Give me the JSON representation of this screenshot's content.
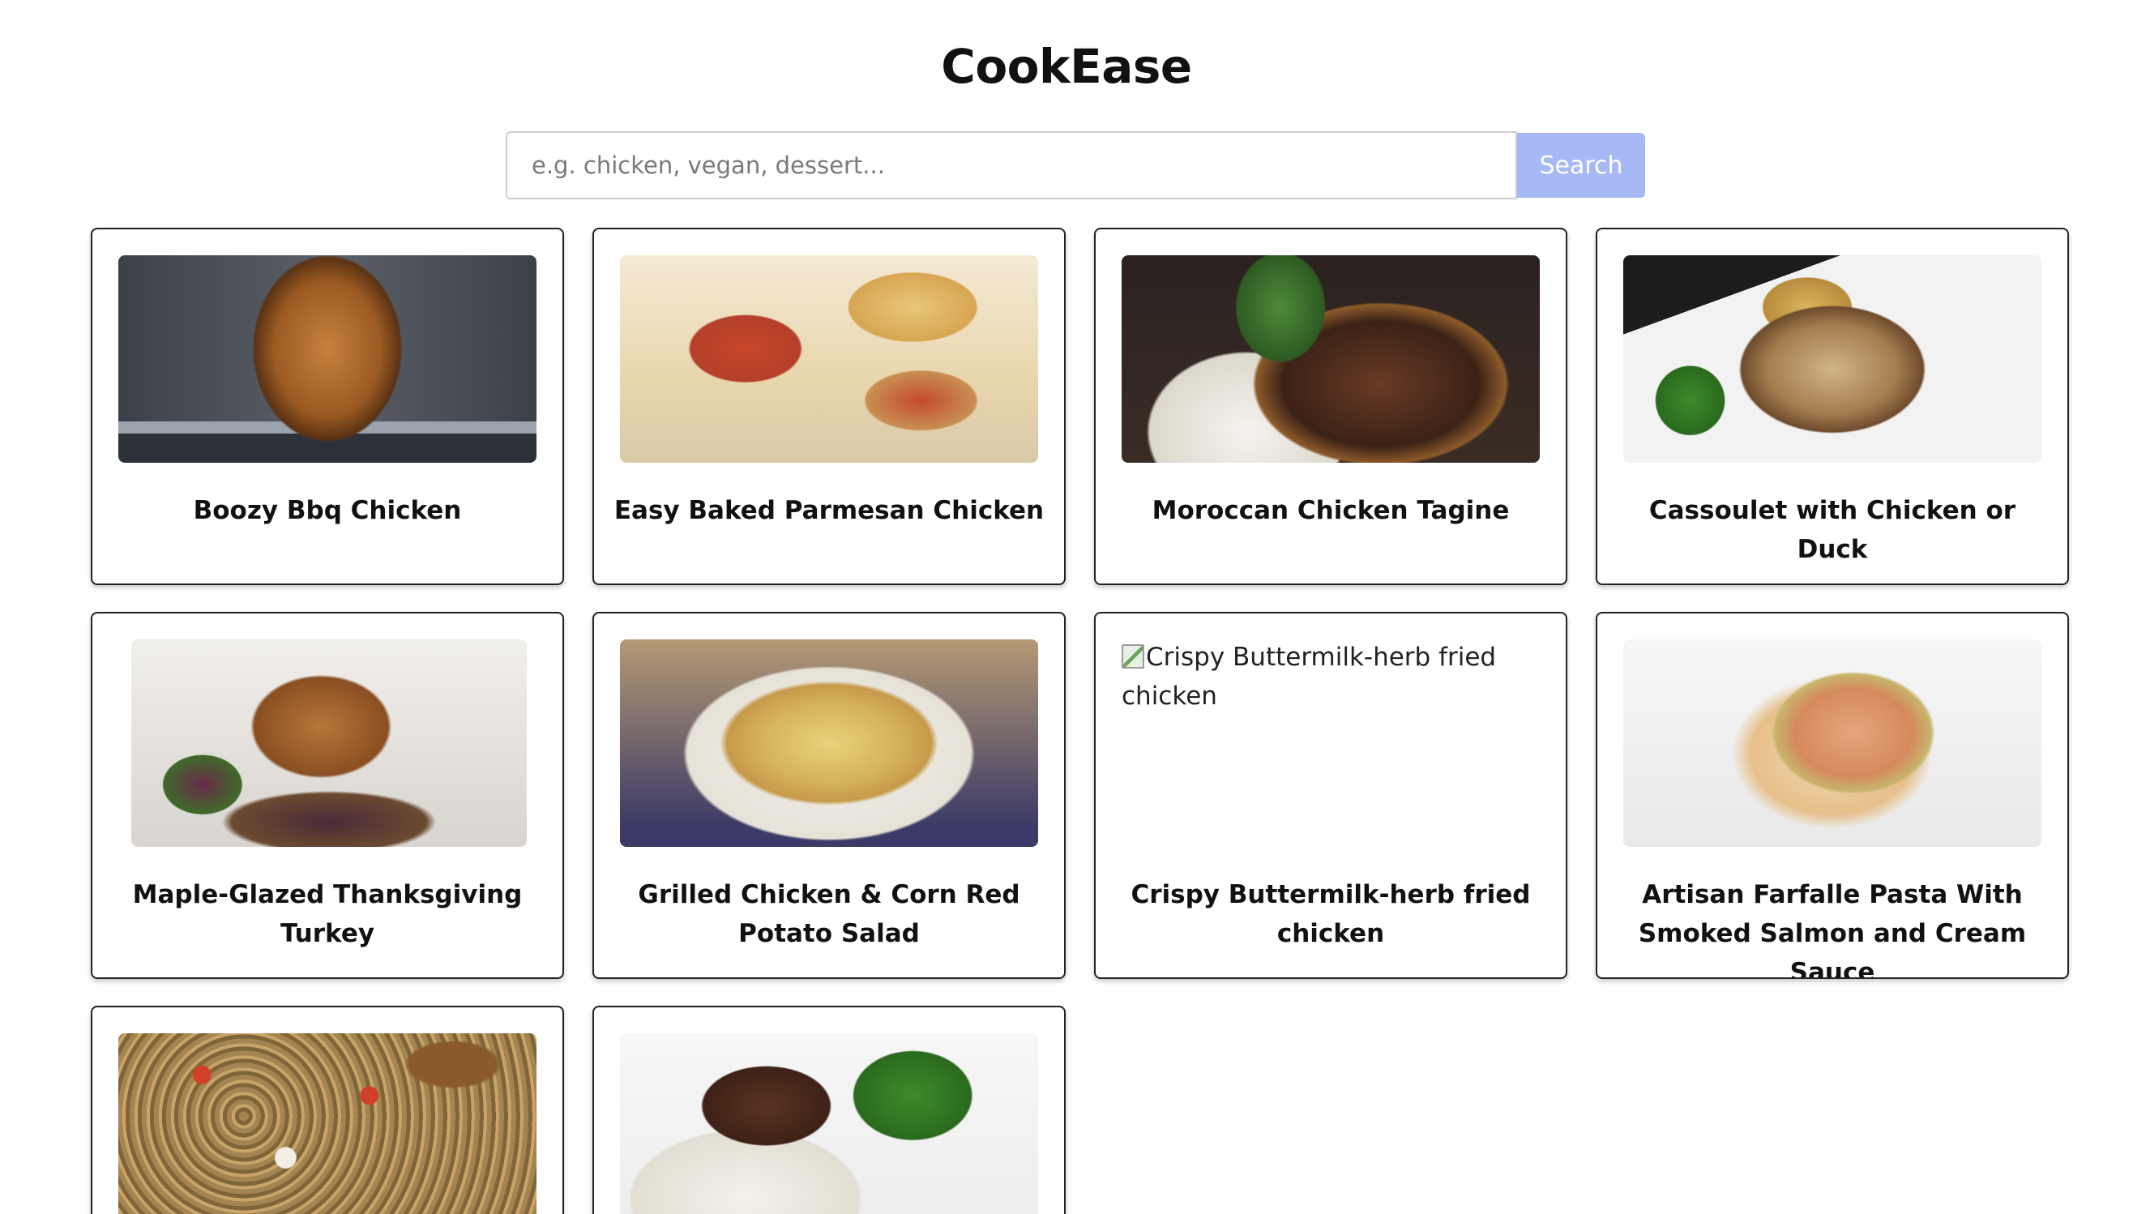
{
  "app": {
    "title": "CookEase"
  },
  "search": {
    "placeholder": "e.g. chicken, vegan, dessert...",
    "value": "",
    "button_label": "Search"
  },
  "recipes": [
    {
      "title": "Boozy Bbq Chicken",
      "image_alt": "Boozy Bbq Chicken",
      "image_loaded": true
    },
    {
      "title": "Easy Baked Parmesan Chicken",
      "image_alt": "Easy Baked Parmesan Chicken",
      "image_loaded": true
    },
    {
      "title": "Moroccan Chicken Tagine",
      "image_alt": "Moroccan Chicken Tagine",
      "image_loaded": true
    },
    {
      "title": "Cassoulet with Chicken or Duck",
      "image_alt": "Cassoulet with Chicken or Duck",
      "image_loaded": true
    },
    {
      "title": "Maple-Glazed Thanksgiving Turkey",
      "image_alt": "Maple-Glazed Thanksgiving Turkey",
      "image_loaded": true
    },
    {
      "title": "Grilled Chicken & Corn Red Potato Salad",
      "image_alt": "Grilled Chicken & Corn Red Potato Salad",
      "image_loaded": true
    },
    {
      "title": "Crispy Buttermilk-herb fried chicken",
      "image_alt": "Crispy Buttermilk-herb fried chicken",
      "image_loaded": false
    },
    {
      "title": "Artisan Farfalle Pasta With Smoked Salmon and Cream Sauce",
      "image_alt": "Artisan Farfalle Pasta With Smoked Salmon and Cream Sauce",
      "image_loaded": true
    },
    {
      "title": "",
      "image_alt": "",
      "image_loaded": true
    },
    {
      "title": "",
      "image_alt": "",
      "image_loaded": true
    }
  ],
  "colors": {
    "search_button_bg": "#a6b8f5",
    "card_border": "#222222",
    "page_bg": "#ffffff"
  }
}
